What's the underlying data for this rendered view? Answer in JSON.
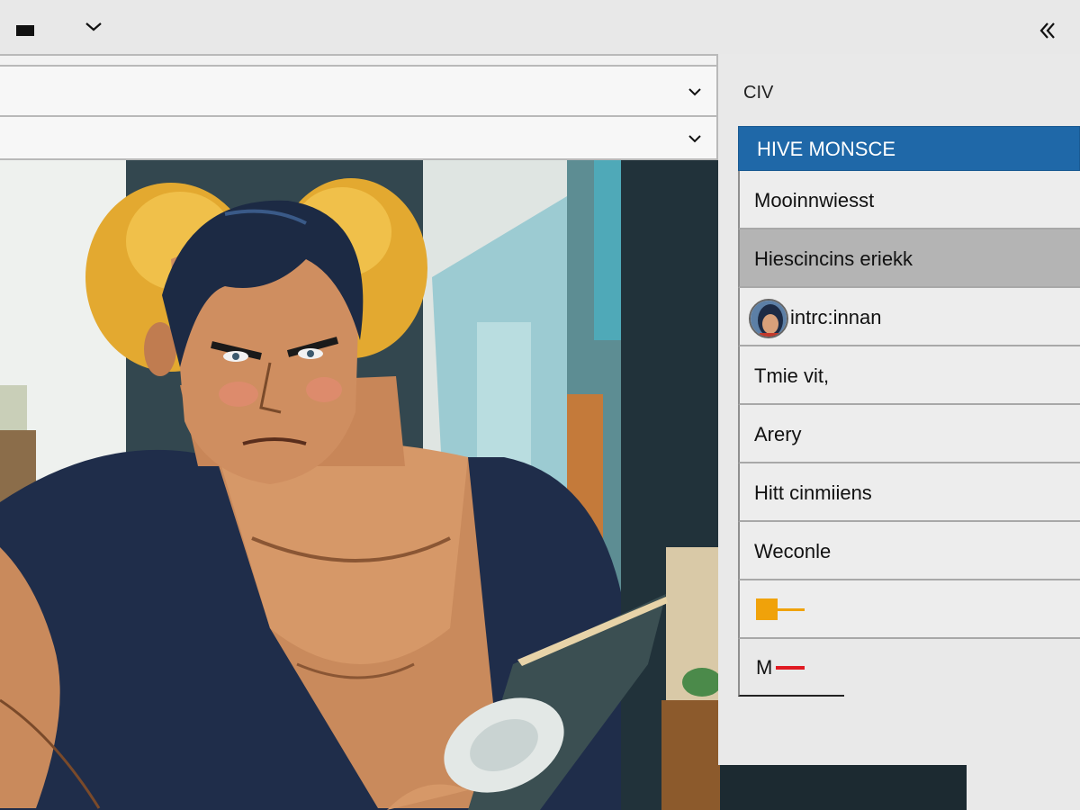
{
  "topbar": {
    "menu_icon": "black-rect-icon",
    "dropdown_icon": "chevron-down-icon",
    "collapse_icon": "double-chevron-left-icon"
  },
  "filters": {
    "row1_value": "",
    "row2_value": ""
  },
  "panel": {
    "title": "CIV",
    "header": "HIVE MONSCE",
    "items": [
      {
        "label": "Mooinnwiesst"
      },
      {
        "label": "Hiescincins eriekk"
      },
      {
        "label": "intrc:innan"
      },
      {
        "label": "Tmie vit,"
      },
      {
        "label": "Arery"
      },
      {
        "label": "Hitt cinmiiens"
      },
      {
        "label": "Weconle"
      },
      {
        "label": ""
      },
      {
        "label": "M"
      }
    ]
  },
  "colors": {
    "accent": "#1f68a8",
    "selected": "#b4b4b4",
    "orange": "#f0a20a",
    "red": "#e01a22"
  }
}
